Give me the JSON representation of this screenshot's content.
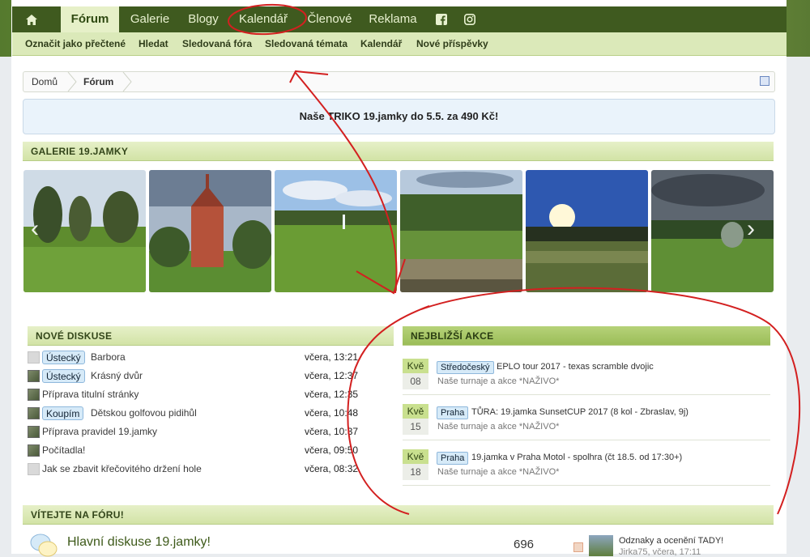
{
  "nav": {
    "tabs": [
      {
        "label": "Fórum",
        "active": true
      },
      {
        "label": "Galerie"
      },
      {
        "label": "Blogy"
      },
      {
        "label": "Kalendář"
      },
      {
        "label": "Členové"
      },
      {
        "label": "Reklama"
      }
    ],
    "icons": [
      "home-icon",
      "facebook-icon",
      "instagram-icon"
    ]
  },
  "subnav": [
    "Označit jako přečtené",
    "Hledat",
    "Sledovaná fóra",
    "Sledovaná témata",
    "Kalendář",
    "Nové příspěvky"
  ],
  "breadcrumb": [
    "Domů",
    "Fórum"
  ],
  "notice": "Naše TRIKO 19.jamky do 5.5. za 490 Kč!",
  "gallery": {
    "title": "GALERIE 19.JAMKY",
    "photos": [
      "park-photo",
      "chapel-photo",
      "fountain-photo",
      "valley-photo",
      "sunset-photo",
      "course-photo"
    ]
  },
  "discussions": {
    "title": "NOVÉ DISKUSE",
    "items": [
      {
        "tag": "Ústecký",
        "title": "Barbora",
        "time": "včera, 13:21",
        "avatar": "blank"
      },
      {
        "tag": "Ústecký",
        "title": "Krásný dvůr",
        "time": "včera, 12:37",
        "avatar": "photo"
      },
      {
        "tag": "",
        "title": "Příprava titulní stránky",
        "time": "včera, 12:35",
        "avatar": "photo"
      },
      {
        "tag": "Koupím",
        "title": "Dětskou golfovou pidihůl",
        "time": "včera, 10:48",
        "avatar": "photo"
      },
      {
        "tag": "",
        "title": "Příprava pravidel 19.jamky",
        "time": "včera, 10:37",
        "avatar": "photo"
      },
      {
        "tag": "",
        "title": "Počítadla!",
        "time": "včera, 09:50",
        "avatar": "photo"
      },
      {
        "tag": "",
        "title": "Jak se zbavit křečovitého držení hole",
        "time": "včera, 08:32",
        "avatar": "blank"
      }
    ]
  },
  "events": {
    "title": "NEJBLIŽŠÍ AKCE",
    "items": [
      {
        "month": "Kvě",
        "day": "08",
        "tag": "Středočeský",
        "title": "EPLO tour 2017 - texas scramble dvojic",
        "sub": "Naše turnaje a akce *NAŽIVO*"
      },
      {
        "month": "Kvě",
        "day": "15",
        "tag": "Praha",
        "title": "TŮRA: 19.jamka SunsetCUP 2017 (8 kol - Zbraslav, 9j)",
        "sub": "Naše turnaje a akce *NAŽIVO*"
      },
      {
        "month": "Kvě",
        "day": "18",
        "tag": "Praha",
        "title": "19.jamka v Praha Motol - spolhra (čt 18.5. od 17:30+)",
        "sub": "Naše turnaje a akce *NAŽIVO*"
      }
    ]
  },
  "welcome": {
    "title": "VÍTEJTE NA FÓRU!",
    "forum_title": "Hlavní diskuse 19.jamky!",
    "count": "696",
    "last_post": "Odznaky a ocenění TADY!",
    "last_post_meta": "Jirka75, včera, 17:11"
  },
  "colors": {
    "nav_bg": "#3f5a1f",
    "accent": "#c9e08f",
    "annotation": "#d32020"
  }
}
